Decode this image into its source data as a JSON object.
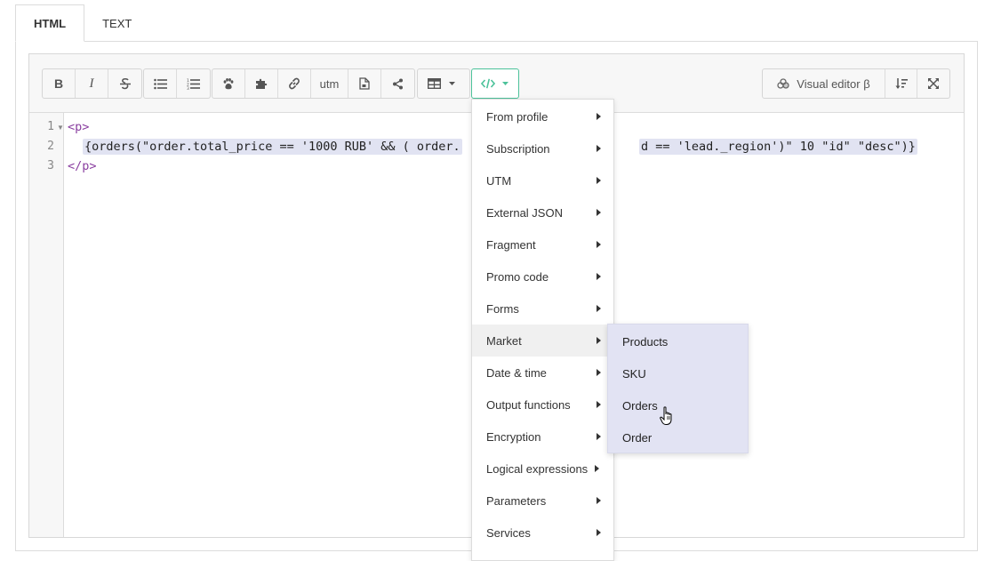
{
  "tabs": [
    {
      "label": "HTML",
      "active": true
    },
    {
      "label": "TEXT",
      "active": false
    }
  ],
  "toolbar": {
    "bold_label": "B",
    "italic_label": "I",
    "utm_label": "utm",
    "visual_editor_label": "Visual editor β",
    "accent_color": "#4cc29a",
    "icons": [
      "bold-icon",
      "italic-icon",
      "strikethrough-icon",
      "bullet-list-icon",
      "numbered-list-icon",
      "paw-icon",
      "puzzle-icon",
      "link-icon",
      "file-icon",
      "share-icon",
      "table-icon",
      "code-icon",
      "sort-icon",
      "fullscreen-icon"
    ]
  },
  "editor": {
    "line_numbers": [
      "1",
      "2",
      "3"
    ],
    "lines": [
      "<p>",
      "{orders(\"order.total_price == '1000 RUB' && ( order.",
      "</p>"
    ],
    "line2_tail": "d == 'lead._region')\" 10 \"id\" \"desc\")}"
  },
  "menu": {
    "items": [
      "From profile",
      "Subscription",
      "UTM",
      "External JSON",
      "Fragment",
      "Promo code",
      "Forms",
      "Market",
      "Date & time",
      "Output functions",
      "Encryption",
      "Logical expressions",
      "Parameters",
      "Services"
    ],
    "active_index": 7
  },
  "submenu": {
    "items": [
      "Products",
      "SKU",
      "Orders",
      "Order"
    ],
    "background": "#e2e3f3"
  }
}
